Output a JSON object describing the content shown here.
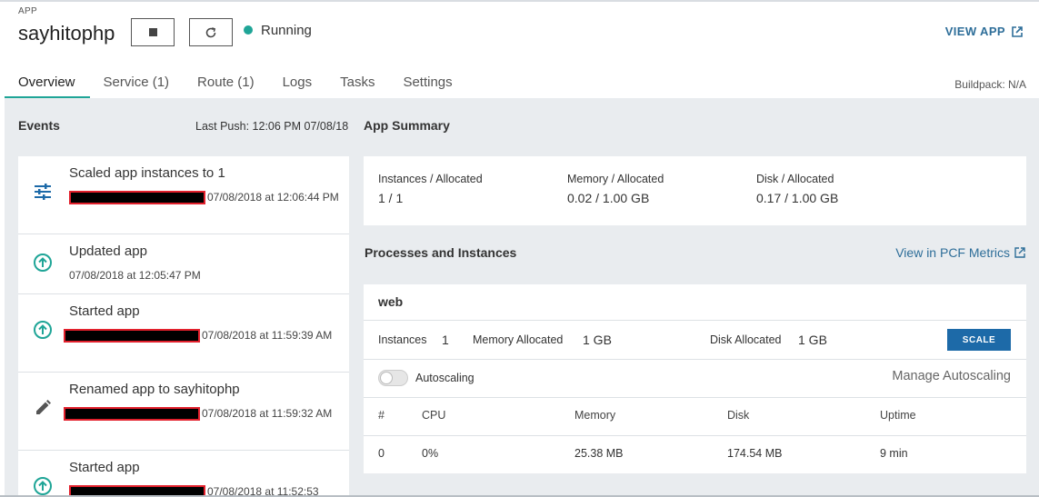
{
  "header": {
    "app_label": "APP",
    "app_name": "sayhitophp",
    "status": "Running",
    "status_color": "#1fa597",
    "view_app": "VIEW APP",
    "buildpack": "Buildpack: N/A"
  },
  "tabs": [
    {
      "label": "Overview",
      "active": true
    },
    {
      "label": "Service (1)"
    },
    {
      "label": "Route (1)"
    },
    {
      "label": "Logs"
    },
    {
      "label": "Tasks"
    },
    {
      "label": "Settings"
    }
  ],
  "events": {
    "title": "Events",
    "last_push": "Last Push: 12:06 PM 07/08/18",
    "items": [
      {
        "icon": "sliders-icon",
        "title": "Scaled app instances to 1",
        "redacted": true,
        "time": "07/08/2018 at 12:06:44 PM"
      },
      {
        "icon": "arrow-up-circle-icon",
        "title": "Updated app",
        "redacted": false,
        "time": "07/08/2018 at 12:05:47 PM"
      },
      {
        "icon": "arrow-up-circle-icon",
        "title": "Started app",
        "redacted": true,
        "time": "07/08/2018 at 11:59:39 AM"
      },
      {
        "icon": "pencil-icon",
        "title": "Renamed app to sayhitophp",
        "redacted": true,
        "time": "07/08/2018 at 11:59:32 AM"
      },
      {
        "icon": "arrow-up-circle-icon",
        "title": "Started app",
        "redacted": true,
        "time": "07/08/2018 at 11:52:53"
      }
    ]
  },
  "summary": {
    "title": "App Summary",
    "instances_label": "Instances / Allocated",
    "instances_value": "1 / 1",
    "memory_label": "Memory / Allocated",
    "memory_value": "0.02 / 1.00 GB",
    "disk_label": "Disk / Allocated",
    "disk_value": "0.17 / 1.00 GB"
  },
  "processes": {
    "title": "Processes and Instances",
    "pcf_link": "View in PCF Metrics",
    "process_name": "web",
    "instances_label": "Instances",
    "instances_value": "1",
    "memory_label": "Memory Allocated",
    "memory_value": "1 GB",
    "disk_label": "Disk Allocated",
    "disk_value": "1 GB",
    "scale_button": "SCALE",
    "autoscaling_label": "Autoscaling",
    "autoscaling_enabled": false,
    "manage_autoscaling": "Manage Autoscaling",
    "columns": [
      "#",
      "CPU",
      "Memory",
      "Disk",
      "Uptime"
    ],
    "rows": [
      [
        "0",
        "0%",
        "25.38 MB",
        "174.54 MB",
        "9 min"
      ]
    ]
  },
  "colors": {
    "accent": "#1fa597",
    "link": "#2e6e99",
    "button": "#1d6aa8",
    "redaction_border": "#e2202c"
  }
}
